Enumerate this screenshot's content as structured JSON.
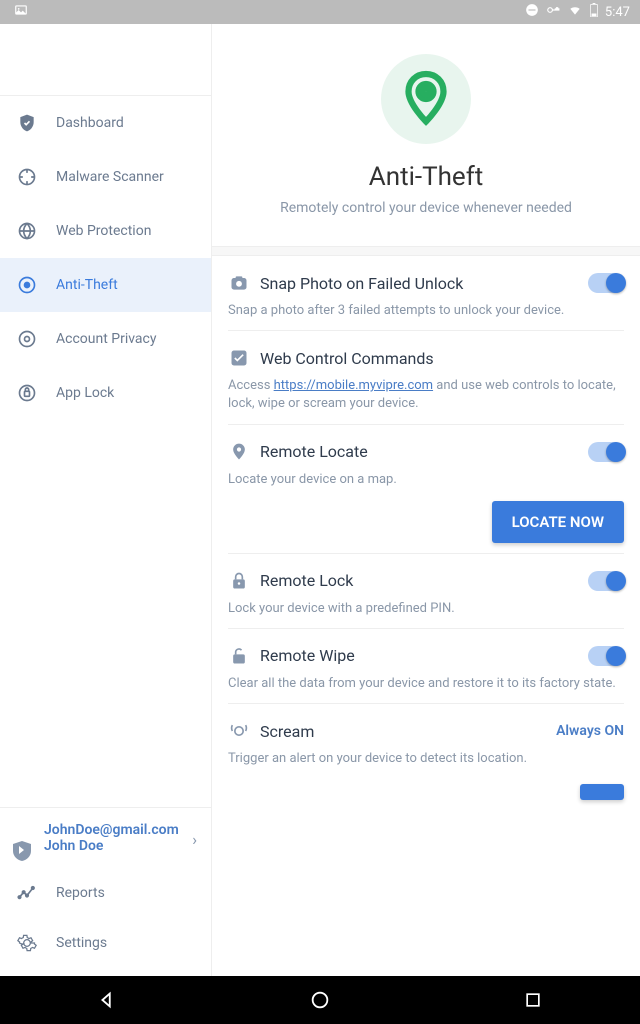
{
  "status_bar": {
    "time": "5:47"
  },
  "sidebar": {
    "items": [
      {
        "label": "Dashboard"
      },
      {
        "label": "Malware Scanner"
      },
      {
        "label": "Web Protection"
      },
      {
        "label": "Anti-Theft"
      },
      {
        "label": "Account Privacy"
      },
      {
        "label": "App Lock"
      }
    ],
    "account": {
      "email": "JohnDoe@gmail.com",
      "name": "John Doe"
    },
    "footer": [
      {
        "label": "Reports"
      },
      {
        "label": "Settings"
      }
    ]
  },
  "hero": {
    "title": "Anti-Theft",
    "subtitle": "Remotely control your device whenever needed"
  },
  "features": {
    "snap_photo": {
      "title": "Snap Photo on Failed Unlock",
      "desc": "Snap a photo after 3 failed attempts to unlock your device.",
      "on": true
    },
    "web_control": {
      "title": "Web Control Commands",
      "desc_prefix": "Access ",
      "link_text": "https://mobile.myvipre.com",
      "desc_suffix": " and use web controls to locate, lock, wipe or scream your device."
    },
    "remote_locate": {
      "title": "Remote Locate",
      "desc": "Locate your device on a map.",
      "button": "LOCATE NOW",
      "on": true
    },
    "remote_lock": {
      "title": "Remote Lock",
      "desc": "Lock your device with a predefined PIN.",
      "on": true
    },
    "remote_wipe": {
      "title": "Remote Wipe",
      "desc": "Clear all the data from your device and restore it to its factory state.",
      "on": true
    },
    "scream": {
      "title": "Scream",
      "status": "Always ON",
      "desc": "Trigger an alert on your device to detect its location."
    }
  }
}
